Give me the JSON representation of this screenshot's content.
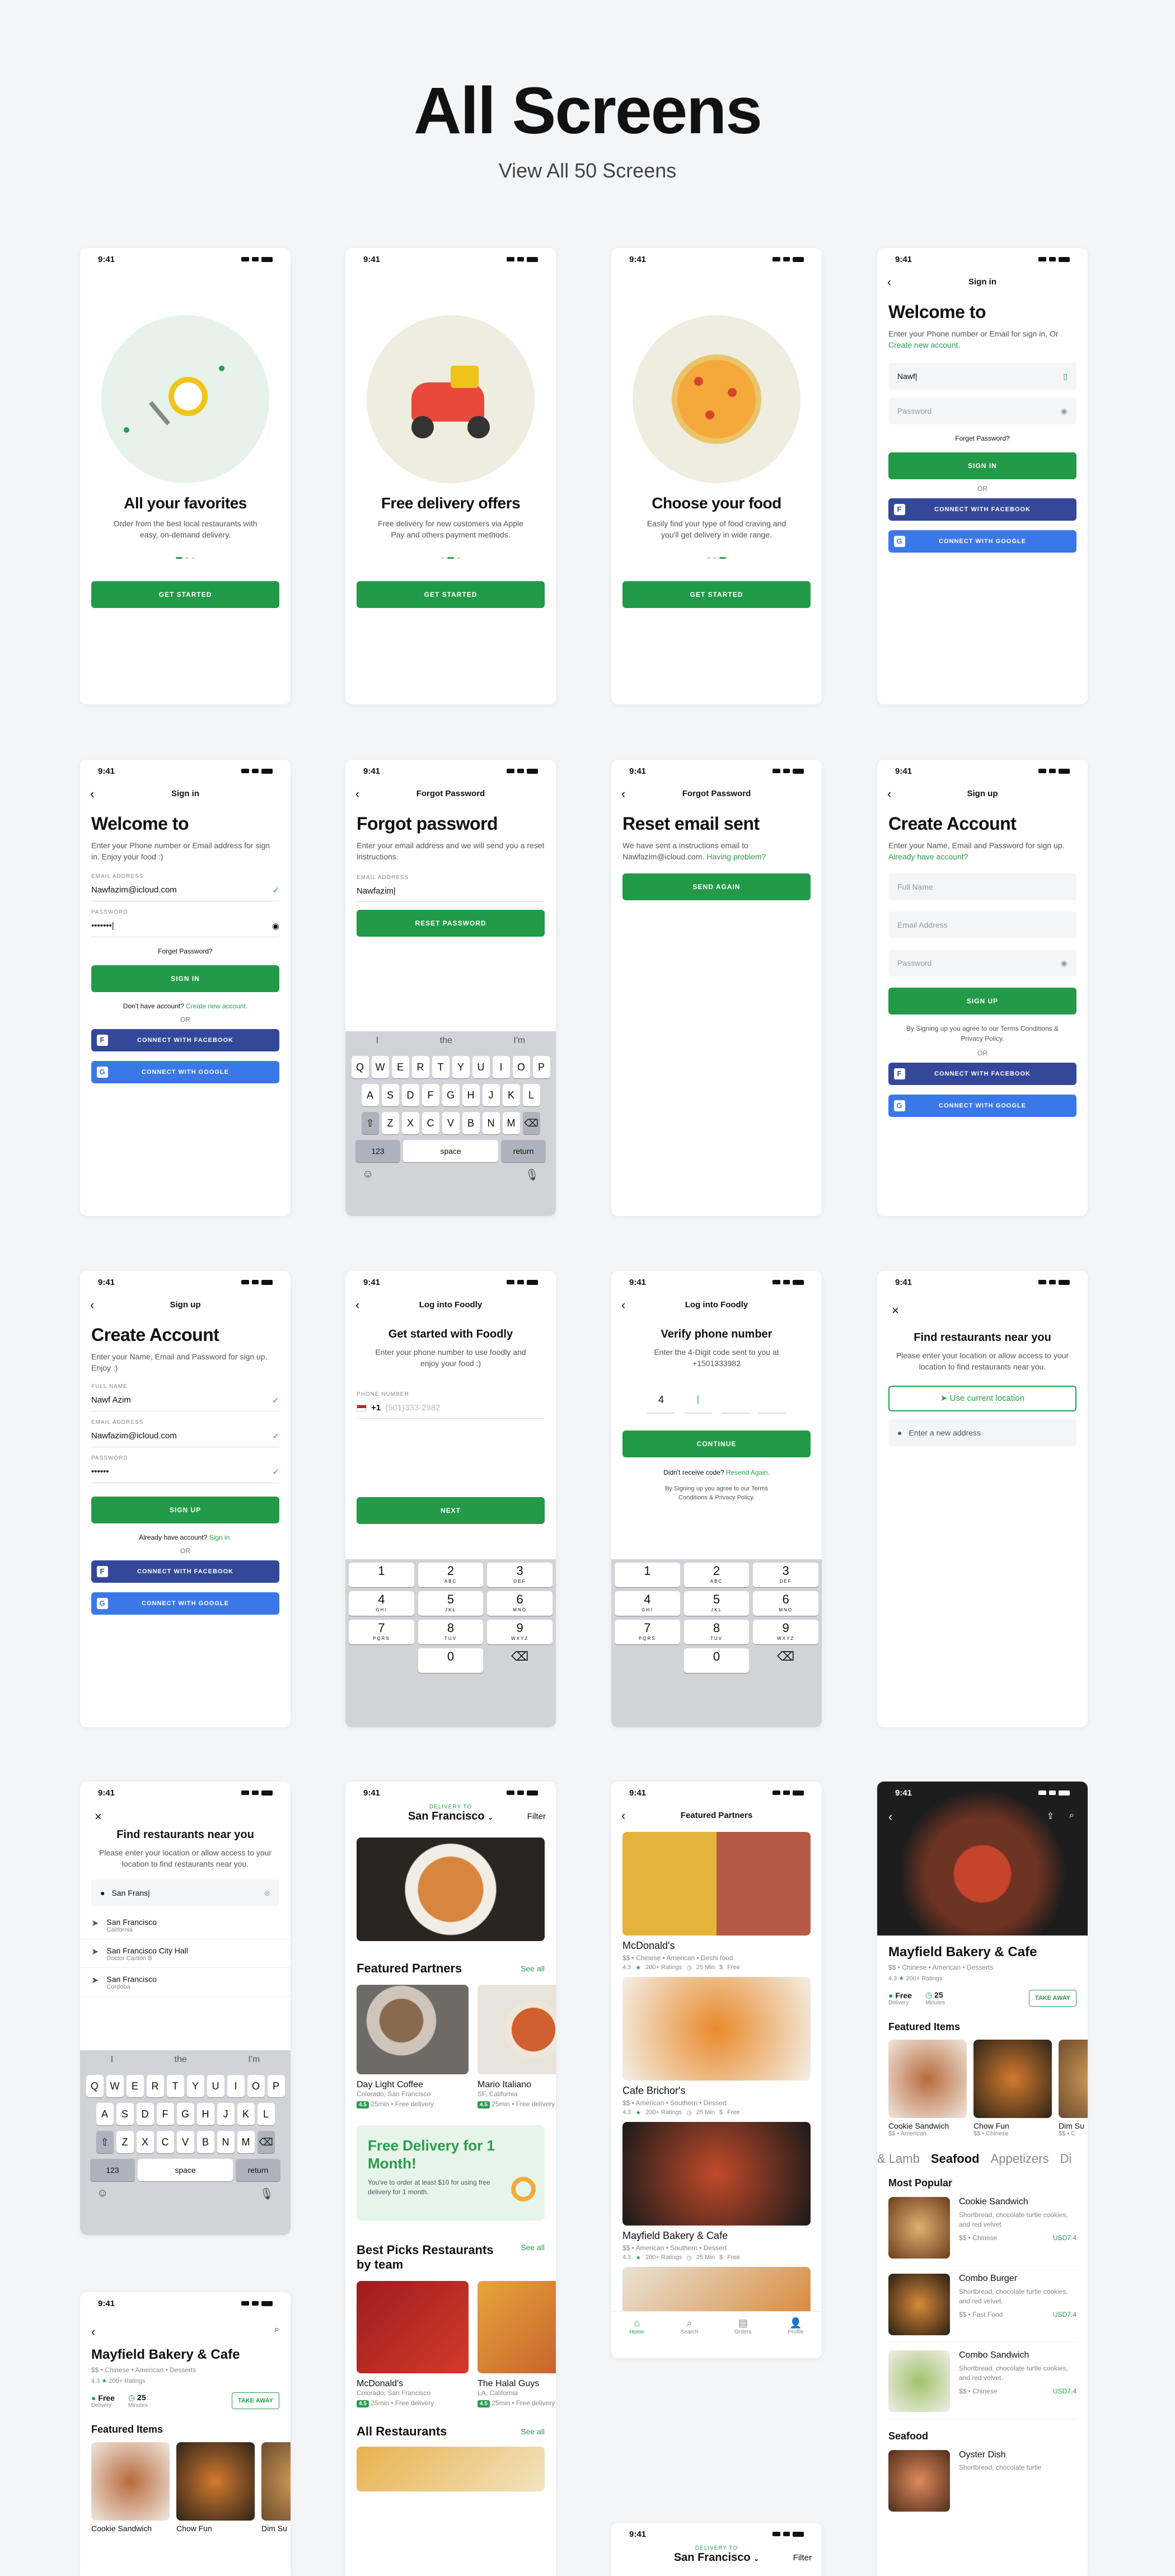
{
  "header": {
    "title": "All Screens",
    "subtitle": "View All 50 Screens"
  },
  "status_time": "9:41",
  "colors": {
    "primary": "#239a48",
    "facebook": "#34489a",
    "google": "#3b78e7"
  },
  "onboard": [
    {
      "title": "All your favorites",
      "text": "Order from the best local restaurants with easy, on-demand delivery.",
      "button": "GET STARTED"
    },
    {
      "title": "Free delivery offers",
      "text": "Free delivery for new customers via Apple Pay and others payment methods.",
      "button": "GET STARTED"
    },
    {
      "title": "Choose your food",
      "text": "Easily find your type of food craving and you'll get delivery in wide range.",
      "button": "GET STARTED"
    }
  ],
  "signin1": {
    "nav": "Sign in",
    "title": "Welcome to",
    "sub_a": "Enter your Phone number or Email for sign in, Or ",
    "sub_link": "Create new account.",
    "field1": "Nawf|",
    "field2": "Password",
    "forgot": "Forget Password?",
    "button": "SIGN IN",
    "or": "OR",
    "fb": "CONNECT WITH FACEBOOK",
    "gg": "CONNECT WITH GOOGLE"
  },
  "signin2": {
    "nav": "Sign in",
    "title": "Welcome to",
    "sub": "Enter your Phone number or Email address for sign in. Enjoy your food :)",
    "email_label": "EMAIL ADDRESS",
    "email": "Nawfazim@icloud.com",
    "pw_label": "PASSWORD",
    "pw": "•••••••|",
    "forgot": "Forget Password?",
    "button": "SIGN IN",
    "no_acc": "Don't have account? ",
    "create": "Create new account.",
    "or": "OR",
    "fb": "CONNECT WITH FACEBOOK",
    "gg": "CONNECT WITH GOOGLE"
  },
  "forgot": {
    "nav": "Forgot Password",
    "title": "Forgot password",
    "sub": "Enter your email address and we will send you a reset instructions.",
    "label": "EMAIL ADDRESS",
    "value": "Nawfazim|",
    "button": "RESET PASSWORD"
  },
  "keyboard": {
    "suggest": [
      "I",
      "the",
      "I'm"
    ],
    "row1": [
      "Q",
      "W",
      "E",
      "R",
      "T",
      "Y",
      "U",
      "I",
      "O",
      "P"
    ],
    "row2": [
      "A",
      "S",
      "D",
      "F",
      "G",
      "H",
      "J",
      "K",
      "L"
    ],
    "row3": [
      "Z",
      "X",
      "C",
      "V",
      "B",
      "N",
      "M"
    ],
    "n123": "123",
    "space": "space",
    "ret": "return"
  },
  "reset": {
    "nav": "Forgot Password",
    "title": "Reset email sent",
    "sub": "We have sent a instructions email to Nawfazim@icloud.com. ",
    "link": "Having problem?",
    "button": "SEND AGAIN"
  },
  "signup1": {
    "nav": "Sign up",
    "title": "Create Account",
    "sub_a": "Enter your Name, Email and Password for sign up. ",
    "sub_link": "Already have account?",
    "f1": "Full Name",
    "f2": "Email Address",
    "f3": "Password",
    "button": "SIGN UP",
    "terms": "By Signing up you agree to our Terms Conditions & Privacy Policy.",
    "or": "OR",
    "fb": "CONNECT WITH FACEBOOK",
    "gg": "CONNECT WITH GOOGLE"
  },
  "signup2": {
    "nav": "Sign up",
    "title": "Create Account",
    "sub": "Enter your Name, Email and Password for sign up. Enjoy :)",
    "l1": "FULL NAME",
    "v1": "Nawf Azim",
    "l2": "EMAIL ADDRESS",
    "v2": "Nawfazim@icloud.com",
    "l3": "PASSWORD",
    "v3": "••••••",
    "button": "SIGN UP",
    "have": "Already have account? ",
    "signin": "Sign in.",
    "or": "OR",
    "fb": "CONNECT WITH FACEBOOK",
    "gg": "CONNECT WITH GOOGLE"
  },
  "login_phone": {
    "nav": "Log into Foodly",
    "title": "Get started with Foodly",
    "sub": "Enter your phone number to use foodly and enjoy your food :)",
    "label": "PHONE NUMBER",
    "code": "+1",
    "placeholder": "(501)333-2982",
    "button": "NEXT"
  },
  "numpad": [
    [
      "1",
      ""
    ],
    [
      "2",
      "ABC"
    ],
    [
      "3",
      "DEF"
    ],
    [
      "4",
      "GHI"
    ],
    [
      "5",
      "JKL"
    ],
    [
      "6",
      "MNO"
    ],
    [
      "7",
      "PQRS"
    ],
    [
      "8",
      "TUV"
    ],
    [
      "9",
      "WXYZ"
    ],
    [
      "",
      ""
    ],
    [
      "0",
      ""
    ],
    [
      "⌫",
      ""
    ]
  ],
  "verify": {
    "nav": "Log into Foodly",
    "title": "Verify phone number",
    "sub_a": "Enter the 4-Digit code sent to you at",
    "phone": "+1501333982",
    "d1": "4",
    "button": "CONTINUE",
    "resend_a": "Didn't receive code? ",
    "resend": "Resend Again.",
    "terms": "By Signing up you agree to our Terms Conditions & Privacy Policy."
  },
  "findnear": {
    "title": "Find restaurants near you",
    "sub": "Please enter your location or allow access to your location to find restaurants near you.",
    "loc_btn": "Use current location",
    "addr": "Enter a new address"
  },
  "findsearch": {
    "title": "Find restaurants near you",
    "sub": "Please enter your location or allow access to your location to find restaurants near you.",
    "query": "San Frans|",
    "results": [
      {
        "name": "San Francisco",
        "sub": "California"
      },
      {
        "name": "San Francisco City Hall",
        "sub": "Doctor Carlton B"
      },
      {
        "name": "San Francisco",
        "sub": "Cordoba"
      }
    ]
  },
  "home": {
    "delivery_to": "DELIVERY TO",
    "city": "San Francisco",
    "filter": "Filter",
    "featured": "Featured Partners",
    "see_all": "See all",
    "p1": "Day Light Coffee",
    "p1_loc": "Colorado, San Francisco",
    "p2": "Mario Italiano",
    "p2_loc": "SF, California",
    "rating": "4.5",
    "time": "25min",
    "free": "Free delivery",
    "promo_title": "Free Delivery for 1 Month!",
    "promo_text": "You've to order at least $10 for using free delivery for 1 month.",
    "best": "Best Picks Restaurants by team",
    "b1": "McDonald's",
    "b1_loc": "Colorado, San Francisco",
    "b2": "The Halal Guys",
    "b2_loc": "LA, California",
    "all": "All Restaurants"
  },
  "featured": {
    "nav": "Featured Partners",
    "items": [
      {
        "name": "McDonald's",
        "tags": "$$ • Chinese • American • Deshi food",
        "rating": "4.3",
        "ratings": "200+ Ratings",
        "time": "25 Min",
        "fee": "Free"
      },
      {
        "name": "Cafe Brichor's",
        "tags": "$$ • American • Southern • Dessert",
        "rating": "4.3",
        "ratings": "200+ Ratings",
        "time": "25 Min",
        "fee": "Free"
      },
      {
        "name": "Mayfield Bakery & Cafe",
        "tags": "$$ • American • Southern • Dessert",
        "rating": "4.3",
        "ratings": "200+ Ratings",
        "time": "25 Min",
        "fee": "Free"
      }
    ],
    "tabs": [
      "Home",
      "Search",
      "Orders",
      "Profile"
    ]
  },
  "rest": {
    "name": "Mayfield Bakery & Cafe",
    "tags": "$$ • Chinese • American • Desserts",
    "rating": "4.3",
    "ratings": "200+ Ratings",
    "free": "Free",
    "free_sub": "Delivery",
    "mins": "25",
    "mins_sub": "Minutes",
    "take": "TAKE AWAY",
    "feat": "Featured Items",
    "fi": [
      {
        "n": "Cookie Sandwich",
        "t": "$$ • American"
      },
      {
        "n": "Chow Fun",
        "t": "$$ • Chinese"
      },
      {
        "n": "Dim Su",
        "t": "$$ • C"
      }
    ],
    "cats": [
      "& Lamb",
      "Seafood",
      "Appetizers",
      "Di"
    ],
    "popular": "Most Popular",
    "menu": [
      {
        "n": "Cookie Sandwich",
        "d": "Shortbread, chocolate turtle cookies, and red velvet.",
        "t": "$$ • Chinese",
        "p": "USD7.4"
      },
      {
        "n": "Combo Burger",
        "d": "Shortbread, chocolate turtle cookies, and red velvet.",
        "t": "$$ • Fast Food",
        "p": "USD7.4"
      },
      {
        "n": "Combo Sandwich",
        "d": "Shortbread, chocolate turtle cookies, and red velvet.",
        "t": "$$ • Chinese",
        "p": "USD7.4"
      }
    ],
    "seafood": "Seafood",
    "oyster": "Oyster Dish",
    "oyster_d": "Shortbread, chocolate turtle"
  },
  "rest2": {
    "name": "Mayfield Bakery & Cafe",
    "tags": "$$ • Chinese • American • Desserts",
    "rating": "4.3",
    "ratings": "200+ Ratings",
    "free": "Free",
    "free_sub": "Delivery",
    "mins": "25",
    "mins_sub": "Minutes",
    "take": "TAKE AWAY",
    "feat": "Featured Items",
    "fi": [
      "Cookie Sandwich",
      "Chow Fun",
      "Dim Su"
    ]
  },
  "home2": {
    "delivery_to": "DELIVERY TO",
    "city": "San Francisco",
    "filter": "Filter"
  }
}
